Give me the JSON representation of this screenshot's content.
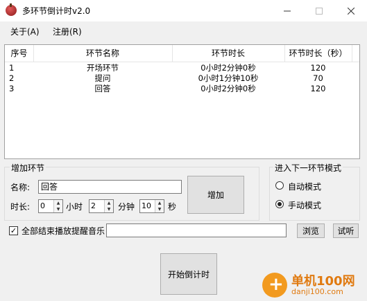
{
  "window": {
    "title": "多环节倒计时v2.0"
  },
  "menu": [
    {
      "label": "关于(A)"
    },
    {
      "label": "注册(R)"
    }
  ],
  "table": {
    "columns": [
      "序号",
      "环节名称",
      "环节时长",
      "环节时长（秒）"
    ],
    "rows": [
      [
        "1",
        "开场环节",
        "0小时2分钟0秒",
        "120"
      ],
      [
        "2",
        "提问",
        "0小时1分钟10秒",
        "70"
      ],
      [
        "3",
        "回答",
        "0小时2分钟0秒",
        "120"
      ]
    ]
  },
  "add_group": {
    "title": "增加环节",
    "name_label": "名称:",
    "name_value": "回答",
    "duration_label": "时长:",
    "hours_value": "0",
    "hours_unit": "小时",
    "minutes_value": "2",
    "minutes_unit": "分钟",
    "seconds_value": "10",
    "seconds_unit": "秒",
    "add_button": "增加"
  },
  "mode_group": {
    "title": "进入下一环节模式",
    "auto_label": "自动模式",
    "manual_label": "手动模式",
    "selected": "manual"
  },
  "music": {
    "checkbox_label": "全部结束播放提醒音乐",
    "checked": true,
    "path_value": "",
    "browse_button": "浏览",
    "test_button": "试听"
  },
  "start_button": "开始倒计时",
  "watermark": {
    "text1": "单机100网",
    "text2": "danji100.com"
  }
}
